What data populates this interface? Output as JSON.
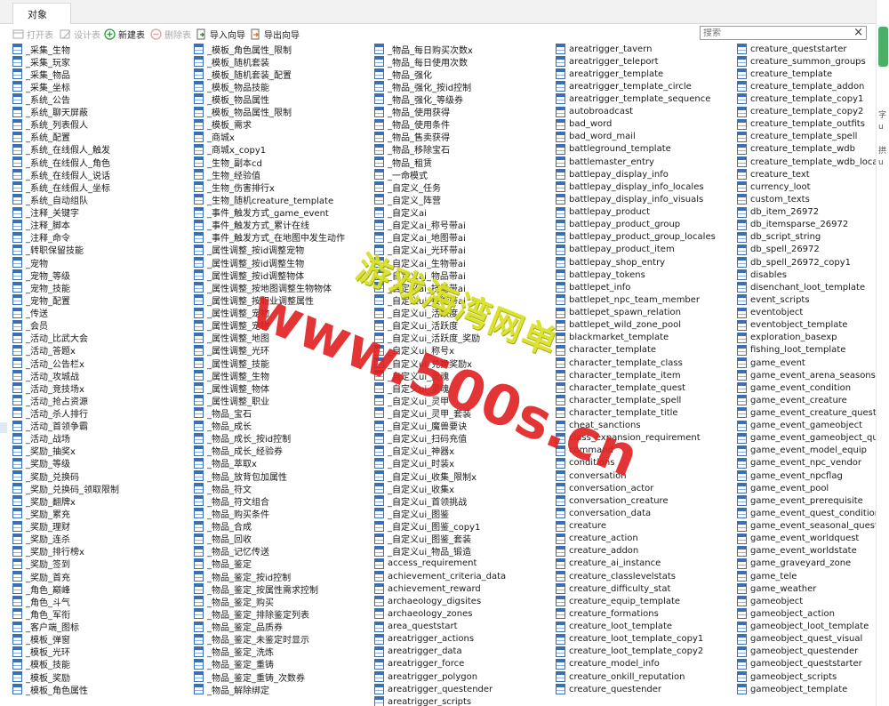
{
  "tab": {
    "label": "对象"
  },
  "toolbar": {
    "open": "打开表",
    "design": "设计表",
    "new": "新建表",
    "delete": "删除表",
    "import": "导入向导",
    "export": "导出向导"
  },
  "search": {
    "placeholder": "搜索"
  },
  "watermark": {
    "line1": "游戏海湾网单",
    "line2": "www.500s.cn"
  },
  "side": {
    "t1": "字",
    "t2": "u",
    "t3": "拱",
    "t4": "u"
  },
  "tables": {
    "col1": [
      "_采集_生物",
      "_采集_玩家",
      "_采集_物品",
      "_采集_坐标",
      "_系统_公告",
      "_系统_聊天屏蔽",
      "_系统_列表假人",
      "_系统_配置",
      "_系统_在线假人_触发",
      "_系统_在线假人_角色",
      "_系统_在线假人_说话",
      "_系统_在线假人_坐标",
      "_系统_自动组队",
      "_注释_关键字",
      "_注释_脚本",
      "_注释_命令",
      "_转职保留技能",
      "_宠物",
      "_宠物_等级",
      "_宠物_技能",
      "_宠物_配置",
      "_传送",
      "_会员",
      "_活动_比武大会",
      "_活动_答题x",
      "_活动_公告栏x",
      "_活动_攻城战",
      "_活动_竞技场x",
      "_活动_抢占资源",
      "_活动_杀人排行",
      "_活动_首领争霸",
      "_活动_战场",
      "_奖励_抽奖x",
      "_奖励_等级",
      "_奖励_兑换码",
      "_奖励_兑换码_领取限制",
      "_奖励_翻牌x",
      "_奖励_累充",
      "_奖励_理财",
      "_奖励_连杀",
      "_奖励_排行榜x",
      "_奖励_签到",
      "_奖励_首充",
      "_角色_巅峰",
      "_角色_斗气",
      "_角色_军衔",
      "_客户端_图标",
      "_模板_弹窗",
      "_模板_光环",
      "_模板_技能",
      "_模板_奖励",
      "_模板_角色属性"
    ],
    "col2": [
      "_模板_角色属性_限制",
      "_模板_随机套装",
      "_模板_随机套装_配置",
      "_模板_物品技能",
      "_模板_物品属性",
      "_模板_物品属性_限制",
      "_模板_需求",
      "_商城x",
      "_商城x_copy1",
      "_生物_副本cd",
      "_生物_经验值",
      "_生物_伤害排行x",
      "_生物_随机creature_template",
      "_事件_触发方式_game_event",
      "_事件_触发方式_累计在线",
      "_事件_触发方式_在地图中发生动作",
      "_属性调整_按id调整宠物",
      "_属性调整_按id调整生物",
      "_属性调整_按id调整物体",
      "_属性调整_按地图调整生物物体",
      "_属性调整_按职业调整属性",
      "_属性调整_宠物",
      "_属性调整_宠物",
      "_属性调整_地图",
      "_属性调整_光环",
      "_属性调整_技能",
      "_属性调整_生物",
      "_属性调整_物体",
      "_属性调整_职业",
      "_物品_宝石",
      "_物品_成长",
      "_物品_成长_按id控制",
      "_物品_成长_经验券",
      "_物品_萃取x",
      "_物品_放背包加属性",
      "_物品_符文",
      "_物品_符文组合",
      "_物品_购买条件",
      "_物品_合成",
      "_物品_回收",
      "_物品_记忆传送",
      "_物品_鉴定",
      "_物品_鉴定_按id控制",
      "_物品_鉴定_按属性需求控制",
      "_物品_鉴定_购买",
      "_物品_鉴定_排除鉴定列表",
      "_物品_鉴定_品质券",
      "_物品_鉴定_未鉴定时显示",
      "_物品_鉴定_洗炼",
      "_物品_鉴定_重铸",
      "_物品_鉴定_重铸_次数券",
      "_物品_解除绑定"
    ],
    "col3": [
      "_物品_每日购买次数x",
      "_物品_每日使用次数",
      "_物品_强化",
      "_物品_强化_按id控制",
      "_物品_强化_等级券",
      "_物品_使用获得",
      "_物品_使用条件",
      "_物品_售卖获得",
      "_物品_移除宝石",
      "_物品_租赁",
      "_一命模式",
      "_自定义_任务",
      "_自定义_阵营",
      "_自定义ai",
      "_自定义ai_称号带ai",
      "_自定义ai_地图带ai",
      "_自定义ai_光环带ai",
      "_自定义ai_生物带ai",
      "_自定义ai_物品带ai",
      "_自定义ai_技能带ai",
      "_自定义ui_技能带ai",
      "_自定义ui_活跃度",
      "_自定义ui_活跃度",
      "_自定义ui_活跃度_奖励",
      "_自定义ui_称号x",
      "_自定义ui_兑换奖励x",
      "_自定义ui_灵魂",
      "_自定义ui_灵魂",
      "_自定义ui_灵甲",
      "_自定义ui_灵甲_套装",
      "_自定义ui_魔兽要诀",
      "_自定义ui_扫码充值",
      "_自定义ui_神器x",
      "_自定义ui_时装x",
      "_自定义ui_收集_限制x",
      "_自定义ui_收集x",
      "_自定义ui_首领挑战",
      "_自定义ui_图鉴",
      "_自定义ui_图鉴_copy1",
      "_自定义ui_图鉴_套装",
      "_自定义ui_物品_锻造",
      "access_requirement",
      "achievement_criteria_data",
      "achievement_reward",
      "archaeology_digsites",
      "archaeology_zones",
      "area_queststart",
      "areatrigger_actions",
      "areatrigger_data",
      "areatrigger_force",
      "areatrigger_polygon",
      "areatrigger_questender",
      "areatrigger_scripts"
    ],
    "col4": [
      "areatrigger_tavern",
      "areatrigger_teleport",
      "areatrigger_template",
      "areatrigger_template_circle",
      "areatrigger_template_sequence",
      "autobroadcast",
      "bad_word",
      "bad_word_mail",
      "battleground_template",
      "battlemaster_entry",
      "battlepay_display_info",
      "battlepay_display_info_locales",
      "battlepay_display_info_visuals",
      "battlepay_product",
      "battlepay_product_group",
      "battlepay_product_group_locales",
      "battlepay_product_item",
      "battlepay_shop_entry",
      "battlepay_tokens",
      "battlepet_info",
      "battlepet_npc_team_member",
      "battlepet_spawn_relation",
      "battlepet_wild_zone_pool",
      "blackmarket_template",
      "character_template",
      "character_template_class",
      "character_template_item",
      "character_template_quest",
      "character_template_spell",
      "character_template_title",
      "cheat_sanctions",
      "class_expansion_requirement",
      "command",
      "conditions",
      "conversation",
      "conversation_actor",
      "conversation_creature",
      "conversation_data",
      "creature",
      "creature_action",
      "creature_addon",
      "creature_ai_instance",
      "creature_classlevelstats",
      "creature_difficulty_stat",
      "creature_equip_template",
      "creature_formations",
      "creature_loot_template",
      "creature_loot_template_copy1",
      "creature_loot_template_copy2",
      "creature_model_info",
      "creature_onkill_reputation",
      "creature_questender"
    ],
    "col5": [
      "creature_queststarter",
      "creature_summon_groups",
      "creature_template",
      "creature_template_addon",
      "creature_template_copy1",
      "creature_template_copy2",
      "creature_template_outfits",
      "creature_template_spell",
      "creature_template_wdb",
      "creature_template_wdb_locale",
      "creature_text",
      "currency_loot",
      "custom_texts",
      "db_item_26972",
      "db_itemsparse_26972",
      "db_script_string",
      "db_spell_26972",
      "db_spell_26972_copy1",
      "disables",
      "disenchant_loot_template",
      "event_scripts",
      "eventobject",
      "eventobject_template",
      "exploration_basexp",
      "fishing_loot_template",
      "game_event",
      "game_event_arena_seasons",
      "game_event_condition",
      "game_event_creature",
      "game_event_creature_quest",
      "game_event_gameobject",
      "game_event_gameobject_quest",
      "game_event_model_equip",
      "game_event_npc_vendor",
      "game_event_npcflag",
      "game_event_pool",
      "game_event_prerequisite",
      "game_event_quest_condition",
      "game_event_seasonal_questrel",
      "game_event_worldquest",
      "game_event_worldstate",
      "game_graveyard_zone",
      "game_tele",
      "game_weather",
      "gameobject",
      "gameobject_action",
      "gameobject_loot_template",
      "gameobject_quest_visual",
      "gameobject_questender",
      "gameobject_queststarter",
      "gameobject_scripts",
      "gameobject_template"
    ]
  }
}
